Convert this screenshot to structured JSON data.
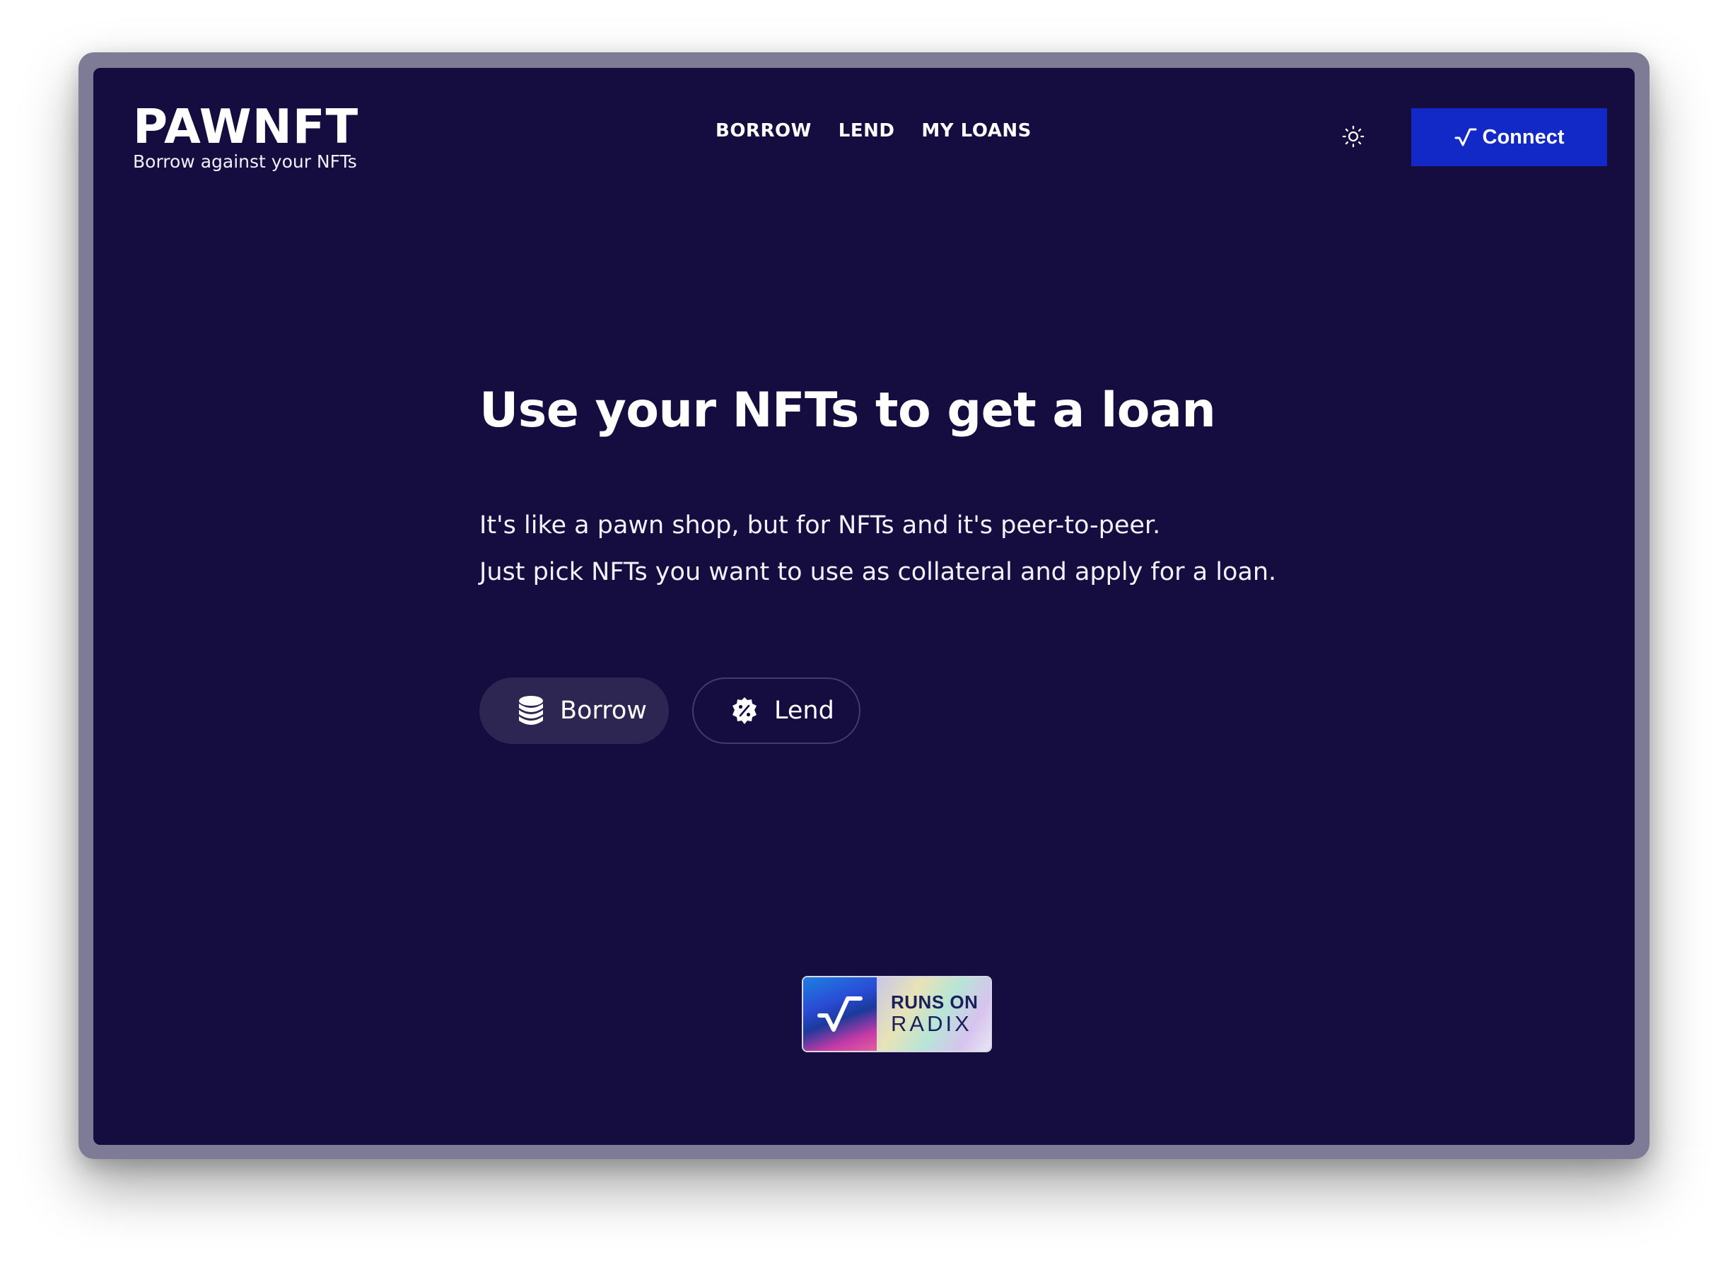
{
  "brand": {
    "title": "PAWNFT",
    "tagline": "Borrow against your NFTs"
  },
  "nav": {
    "items": [
      {
        "label": "BORROW"
      },
      {
        "label": "LEND"
      },
      {
        "label": "MY LOANS"
      }
    ]
  },
  "header": {
    "theme_toggle_icon": "sun-icon",
    "connect_label": "Connect",
    "connect_icon": "radix-check-icon",
    "connect_color": "#1229c7"
  },
  "hero": {
    "title": "Use your NFTs to get a loan",
    "line1": "It's like a pawn shop, but for NFTs and it's peer-to-peer.",
    "line2": "Just pick NFTs you want to use as collateral and apply for a loan.",
    "actions": {
      "borrow_label": "Borrow",
      "borrow_icon": "coins-stack-icon",
      "lend_label": "Lend",
      "lend_icon": "percent-badge-icon"
    }
  },
  "badge": {
    "line1": "RUNS ON",
    "line2": "RADIX"
  },
  "colors": {
    "background": "#150d40",
    "frame": "#7d7b95",
    "pill": "#2d2653"
  }
}
